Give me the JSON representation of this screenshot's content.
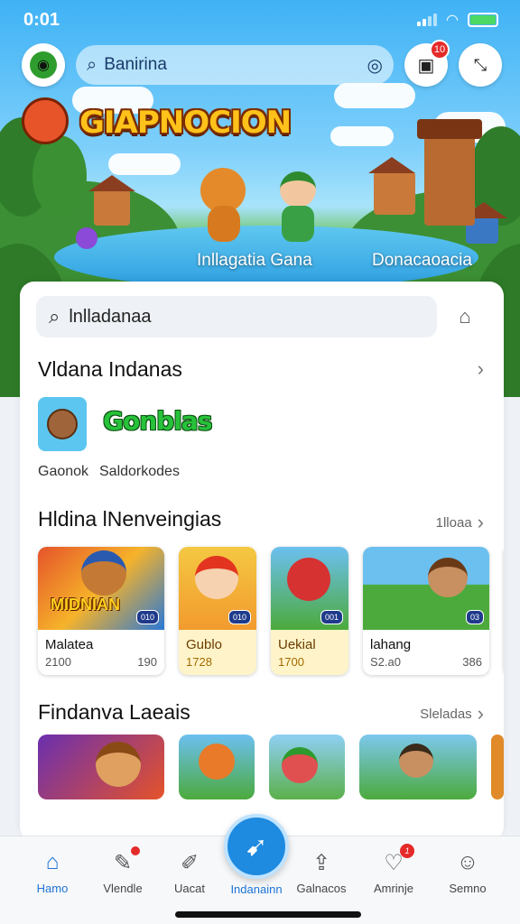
{
  "status_bar": {
    "time": "0:01"
  },
  "top_bar": {
    "search_text": "Banirina",
    "notification_count": "10"
  },
  "hero": {
    "logo_text": "GIAPNOCION",
    "label_left": "Inllagatia Gana",
    "label_right": "Donacaoacia"
  },
  "main_search": {
    "text": "lnlladanaa"
  },
  "section1": {
    "title": "Vldana Indanas",
    "featured_title": "Gonblas",
    "sub1": "Gaonok",
    "sub2": "Saldorkodes"
  },
  "section2": {
    "title": "Hldina lNenveingias",
    "more_label": "1lloaa",
    "games": [
      {
        "name": "Malatea",
        "meta_left": "2100",
        "meta_right": "190",
        "thumb_text": "MIDNIAN",
        "badge": "010"
      },
      {
        "name": "Gublo",
        "meta_left": "1728",
        "meta_right": "",
        "badge": "010"
      },
      {
        "name": "Uekial",
        "meta_left": "1700",
        "meta_right": "",
        "badge": "001"
      },
      {
        "name": "lahang",
        "meta_left": "S2.a0",
        "meta_right": "386",
        "badge": "03"
      }
    ]
  },
  "section3": {
    "title": "Findanva Laeais",
    "more_label": "Sleladas"
  },
  "bottom_nav": [
    {
      "label": "Hamo"
    },
    {
      "label": "Vlendle"
    },
    {
      "label": "Uacat"
    },
    {
      "label": "Indanainn"
    },
    {
      "label": "Galnacos"
    },
    {
      "label": "Amrinje",
      "badge": "1"
    },
    {
      "label": "Semno"
    }
  ],
  "colors": {
    "accent": "#1e74d6",
    "badge_red": "#e52a2a",
    "sky": "#3fb2f5",
    "logo_gold": "#ffc21a",
    "featured_green": "#27c23a"
  },
  "icons": [
    "frog-avatar-icon",
    "search-icon",
    "scan-icon",
    "gift-icon",
    "expand-icon",
    "home-icon",
    "edit-icon",
    "pen-icon",
    "compass-icon",
    "share-icon",
    "chat-icon",
    "user-icon"
  ]
}
